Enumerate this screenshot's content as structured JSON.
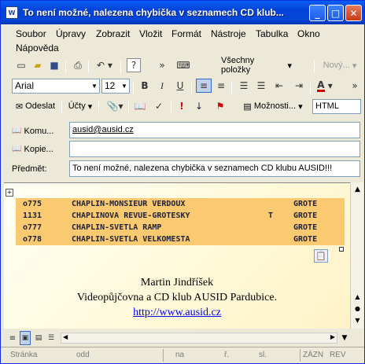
{
  "window": {
    "title": "To není možné, nalezena chybička v seznamech CD klub...",
    "app_icon": "W"
  },
  "menu": [
    "Soubor",
    "Úpravy",
    "Zobrazit",
    "Vložit",
    "Formát",
    "Nástroje",
    "Tabulka",
    "Okno",
    "Nápověda"
  ],
  "toolbar1": {
    "all_items": "Všechny položky",
    "new": "Nový..."
  },
  "format": {
    "font": "Arial",
    "size": "12"
  },
  "toolbar3": {
    "send": "Odeslat",
    "accounts": "Účty",
    "options": "Možnosti...",
    "format_mode": "HTML"
  },
  "header": {
    "to_label": "Komu...",
    "to_value": "ausid@ausid.cz",
    "cc_label": "Kopie...",
    "cc_value": "",
    "subject_label": "Předmět:",
    "subject_value": "To není možné, nalezena chybička v seznamech CD klubu AUSID!!!"
  },
  "rows": [
    {
      "code": "o775",
      "title": "CHAPLIN-MONSIEUR VERDOUX",
      "flag": "",
      "publisher": "GROTE"
    },
    {
      "code": "1131",
      "title": "CHAPLINOVA REVUE-GROTESKY",
      "flag": "T",
      "publisher": "GROTE"
    },
    {
      "code": "o777",
      "title": "CHAPLIN-SVETLA RAMP",
      "flag": "",
      "publisher": "GROTE"
    },
    {
      "code": "o778",
      "title": "CHAPLIN-SVETLA VELKOMESTA",
      "flag": "",
      "publisher": "GROTE"
    }
  ],
  "signature": {
    "name": "Martin Jindříšek",
    "company": "Videopůjčovna a CD klub AUSID Pardubice.",
    "url": "http://www.ausid.cz"
  },
  "status": {
    "page": "Stránka",
    "section": "odd",
    "at": "na",
    "line": "ř.",
    "col": "sl.",
    "rec": "ZÁZN",
    "rev": "REV"
  },
  "colors": {
    "highlight": "#fac970",
    "titlebar": "#0441d8",
    "link": "#0000ee"
  }
}
